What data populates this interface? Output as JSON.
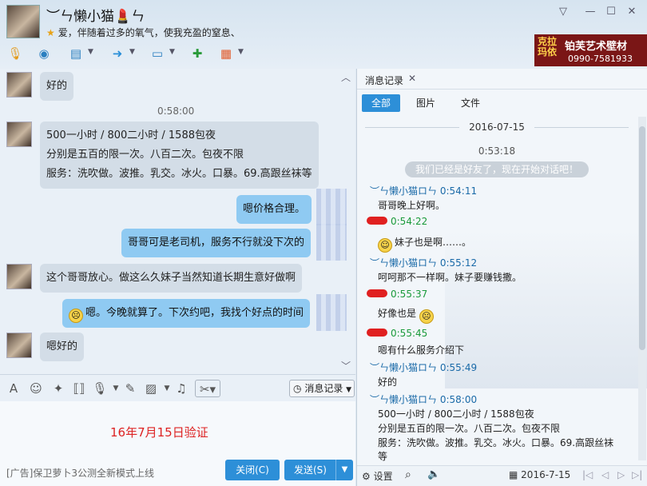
{
  "header": {
    "nickname": "︶ㄣ懒小猫💄ㄣ",
    "signature": "爱，伴随着过多的氧气，使我充盈的窒息、",
    "window_controls": [
      "minimize-arrow",
      "minimize",
      "maximize",
      "close"
    ]
  },
  "toolbar": {
    "icons": [
      "microphone-icon",
      "webcam-icon",
      "screen-share-icon",
      "file-transfer-icon",
      "remote-desktop-icon",
      "add-contact-icon",
      "apps-icon"
    ]
  },
  "ad_banner": {
    "brand_a": "克拉玛依",
    "brand_b": "铂芙艺术壁材",
    "phone": "0990-7581933"
  },
  "chat": {
    "messages": [
      {
        "side": "in",
        "lines": [
          "好的"
        ]
      },
      {
        "side": "time",
        "text": "0:58:00"
      },
      {
        "side": "in",
        "lines": [
          "500一小时 / 800二小时 / 1588包夜",
          "分别是五百的限一次。八百二次。包夜不限",
          "服务：洗吹做。波推。乳交。冰火。口暴。69.高跟丝袜等"
        ]
      },
      {
        "side": "out",
        "lines": [
          "嗯价格合理。"
        ]
      },
      {
        "side": "out",
        "lines": [
          "哥哥可是老司机，服务不行就没下次的"
        ]
      },
      {
        "side": "in",
        "lines": [
          "这个哥哥放心。做这么久妹子当然知道长期生意好做啊"
        ]
      },
      {
        "side": "out",
        "lines": [
          "嗯。今晚就算了。下次约吧，我找个好点的时间"
        ]
      },
      {
        "side": "in",
        "lines": [
          "嗯好的"
        ]
      }
    ]
  },
  "input_toolbar": {
    "history_label": "消息记录"
  },
  "input_area": {
    "verify_text": "16年7月15日验证",
    "bottom_ad": "[广告]保卫萝卜3公测全新模式上线",
    "close_label": "关闭(C)",
    "send_label": "发送(S)"
  },
  "history": {
    "title": "消息记录",
    "filters": [
      "全部",
      "图片",
      "文件"
    ],
    "date": "2016-07-15",
    "first_time": "0:53:18",
    "system_note": "我们已经是好友了，现在开始对话吧！",
    "entries": [
      {
        "kind": "them",
        "name": "︶ㄣ懒小猫ロㄣ",
        "time": "0:54:11",
        "lines": [
          "哥哥晚上好啊。"
        ]
      },
      {
        "kind": "me",
        "time": "0:54:22",
        "lines": [
          "妹子也是啊……。"
        ]
      },
      {
        "kind": "them",
        "name": "︶ㄣ懒小猫ロㄣ",
        "time": "0:55:12",
        "lines": [
          "呵呵那不一样啊。妹子要赚钱撒。"
        ]
      },
      {
        "kind": "me",
        "time": "0:55:37",
        "lines": [
          "好像也是"
        ]
      },
      {
        "kind": "me",
        "time": "0:55:45",
        "lines": [
          "嗯有什么服务介绍下"
        ]
      },
      {
        "kind": "them",
        "name": "︶ㄣ懒小猫ロㄣ",
        "time": "0:55:49",
        "lines": [
          "好的"
        ]
      },
      {
        "kind": "them",
        "name": "︶ㄣ懒小猫ロㄣ",
        "time": "0:58:00",
        "lines": [
          "500一小时 / 800二小时 / 1588包夜",
          "分别是五百的限一次。八百二次。包夜不限",
          "服务：洗吹做。波推。乳交。冰火。口暴。69.高跟丝袜",
          "等"
        ]
      }
    ],
    "footer": {
      "settings": "设置",
      "date": "2016-7-15"
    }
  }
}
